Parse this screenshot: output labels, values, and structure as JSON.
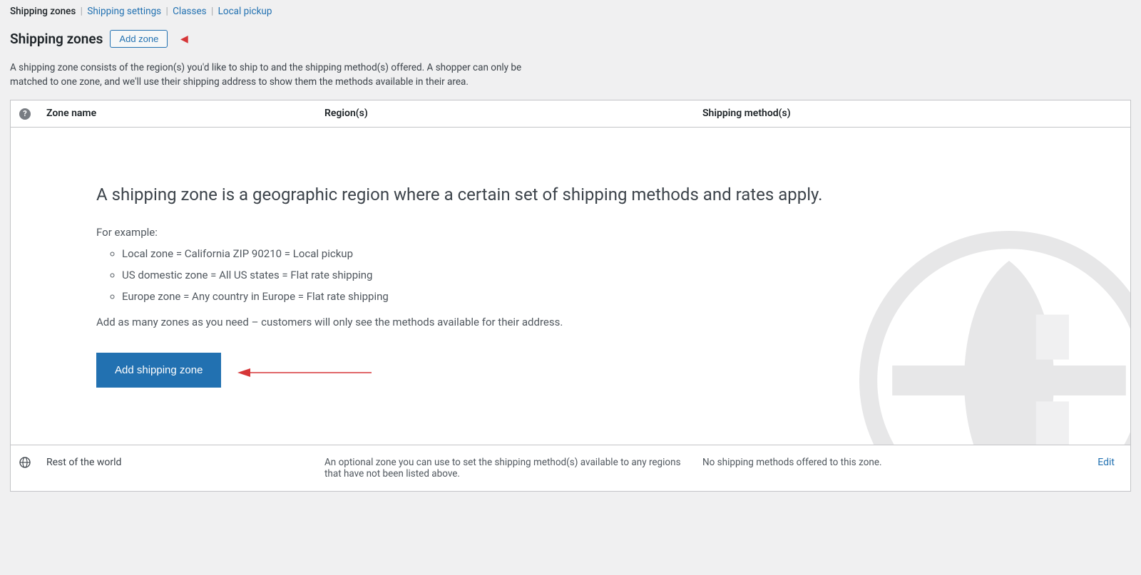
{
  "subnav": {
    "items": [
      {
        "label": "Shipping zones",
        "active": true
      },
      {
        "label": "Shipping settings",
        "active": false
      },
      {
        "label": "Classes",
        "active": false
      },
      {
        "label": "Local pickup",
        "active": false
      }
    ]
  },
  "header": {
    "title": "Shipping zones",
    "add_button": "Add zone"
  },
  "description": "A shipping zone consists of the region(s) you'd like to ship to and the shipping method(s) offered. A shopper can only be matched to one zone, and we'll use their shipping address to show them the methods available in their area.",
  "table": {
    "columns": {
      "name": "Zone name",
      "region": "Region(s)",
      "methods": "Shipping method(s)"
    },
    "empty": {
      "headline": "A shipping zone is a geographic region where a certain set of shipping methods and rates apply.",
      "for_example": "For example:",
      "examples": [
        "Local zone = California ZIP 90210 = Local pickup",
        "US domestic zone = All US states = Flat rate shipping",
        "Europe zone = Any country in Europe = Flat rate shipping"
      ],
      "footer_text": "Add as many zones as you need – customers will only see the methods available for their address.",
      "button": "Add shipping zone"
    },
    "default_row": {
      "name": "Rest of the world",
      "region": "An optional zone you can use to set the shipping method(s) available to any regions that have not been listed above.",
      "methods": "No shipping methods offered to this zone.",
      "edit": "Edit"
    }
  }
}
